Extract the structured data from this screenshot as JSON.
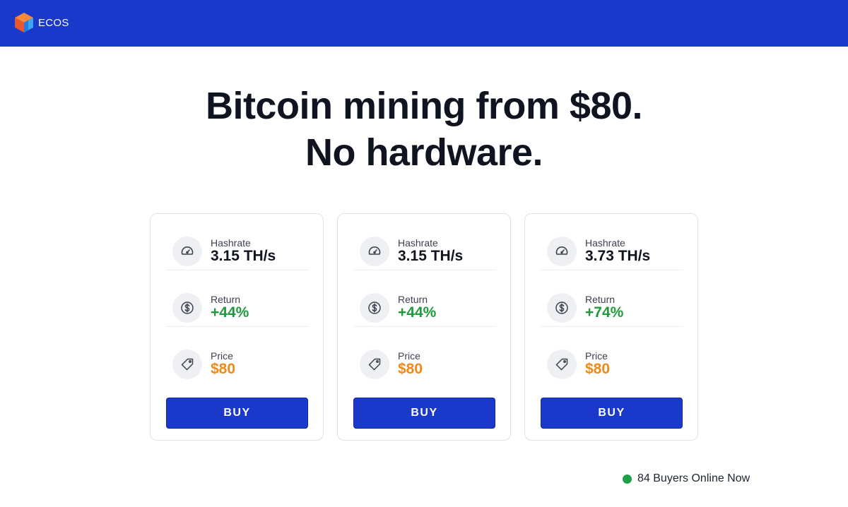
{
  "header": {
    "brand_name": "ECOS",
    "logo_icon": "cube-logo-icon",
    "background_color": "#1a38c9"
  },
  "hero": {
    "line1": "Bitcoin mining from $80.",
    "line2": "No hardware."
  },
  "plans": [
    {
      "hashrate_label": "Hashrate",
      "hashrate_value": "3.15 TH/s",
      "return_label": "Return",
      "return_value": "+44%",
      "price_label": "Price",
      "price_value": "$80",
      "buy_label": "BUY"
    },
    {
      "hashrate_label": "Hashrate",
      "hashrate_value": "3.15 TH/s",
      "return_label": "Return",
      "return_value": "+44%",
      "price_label": "Price",
      "price_value": "$80",
      "buy_label": "BUY"
    },
    {
      "hashrate_label": "Hashrate",
      "hashrate_value": "3.73 TH/s",
      "return_label": "Return",
      "return_value": "+74%",
      "price_label": "Price",
      "price_value": "$80",
      "buy_label": "BUY"
    }
  ],
  "icons": {
    "hashrate": "speedometer-icon",
    "return": "dollar-circle-icon",
    "price": "price-tag-icon"
  },
  "colors": {
    "return_green": "#1e9a3c",
    "price_orange": "#f0891a",
    "online_dot": "#1ea04a"
  },
  "status": {
    "online_text": "84 Buyers Online Now"
  }
}
